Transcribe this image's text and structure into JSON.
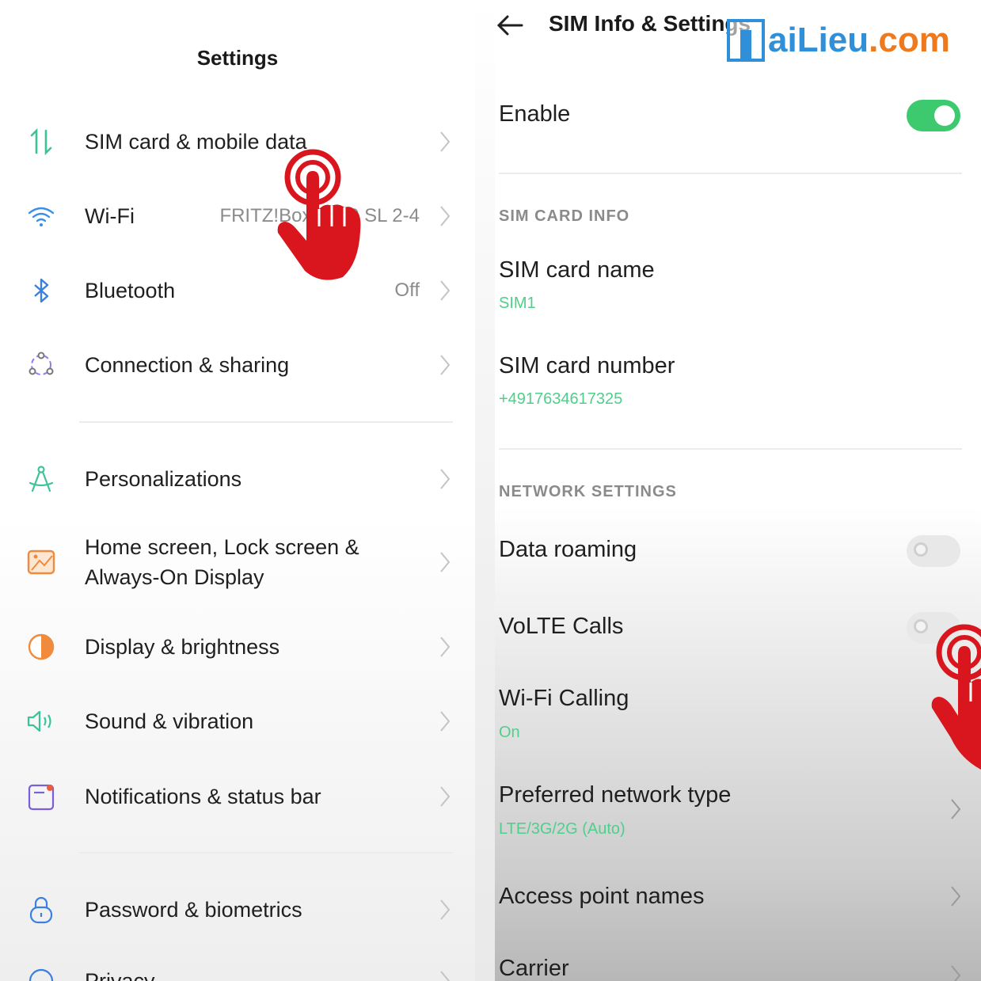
{
  "left": {
    "title": "Settings",
    "items": [
      {
        "label": "SIM card & mobile data",
        "value": "",
        "icon": "mobile-data-icon"
      },
      {
        "label": "Wi-Fi",
        "value": "FRITZ!Box 7490 SL 2-4",
        "icon": "wifi-icon"
      },
      {
        "label": "Bluetooth",
        "value": "Off",
        "icon": "bluetooth-icon"
      },
      {
        "label": "Connection & sharing",
        "value": "",
        "icon": "connection-sharing-icon"
      },
      {
        "label": "Personalizations",
        "value": "",
        "icon": "personalization-icon"
      },
      {
        "label_line1": "Home screen, Lock screen &",
        "label_line2": "Always-On Display",
        "icon": "home-screen-icon"
      },
      {
        "label": "Display & brightness",
        "value": "",
        "icon": "display-brightness-icon"
      },
      {
        "label": "Sound & vibration",
        "value": "",
        "icon": "sound-icon"
      },
      {
        "label": "Notifications & status bar",
        "value": "",
        "icon": "notification-icon"
      },
      {
        "label": "Password & biometrics",
        "value": "",
        "icon": "lock-icon"
      },
      {
        "label": "Privacy",
        "value": "",
        "icon": "privacy-icon"
      }
    ]
  },
  "right": {
    "title": "SIM Info & Settings",
    "enable_label": "Enable",
    "enable_on": true,
    "sim_card_info_header": "SIM CARD INFO",
    "sim_card_name_label": "SIM card name",
    "sim_card_name_value": "SIM1",
    "sim_card_number_label": "SIM card number",
    "sim_card_number_value": "+4917634617325",
    "network_settings_header": "NETWORK SETTINGS",
    "data_roaming_label": "Data roaming",
    "data_roaming_on": false,
    "volte_label": "VoLTE Calls",
    "volte_on": false,
    "wifi_calling_label": "Wi-Fi Calling",
    "wifi_calling_value": "On",
    "preferred_network_label": "Preferred network type",
    "preferred_network_value": "LTE/3G/2G (Auto)",
    "apn_label": "Access point names",
    "carrier_label": "Carrier"
  },
  "watermark": {
    "part1": "aiLieu",
    "part2": ".com"
  },
  "colors": {
    "accent_green": "#3dc96e",
    "hand_red": "#d9161d",
    "watermark_blue": "#2f8fd8"
  }
}
